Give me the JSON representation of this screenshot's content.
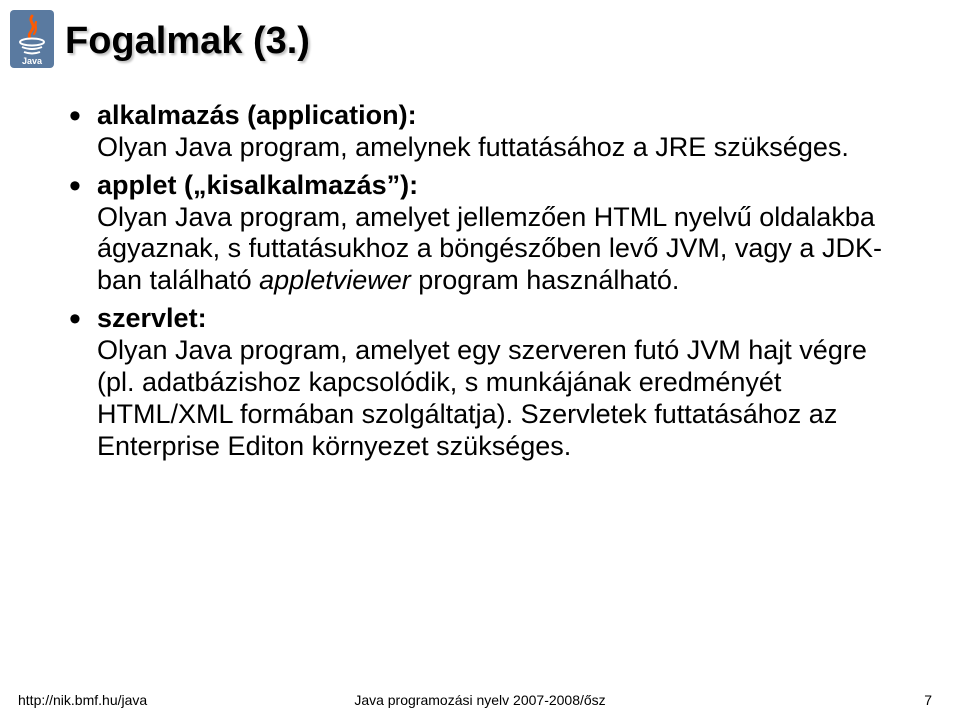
{
  "title": "Fogalmak (3.)",
  "bullets": [
    {
      "term": "alkalmazás (application):",
      "def_parts": [
        {
          "text": "Olyan Java program, amelynek futtatásához a JRE szükséges.",
          "italic": false
        }
      ]
    },
    {
      "term": "applet („kisalkalmazás”):",
      "def_parts": [
        {
          "text": "Olyan Java program, amelyet jellemzően HTML nyelvű oldalakba ágyaznak, s futtatásukhoz a böngészőben levő JVM, vagy a JDK-ban található ",
          "italic": false
        },
        {
          "text": "appletviewer",
          "italic": true
        },
        {
          "text": " program használható.",
          "italic": false
        }
      ]
    },
    {
      "term": "szervlet:",
      "def_parts": [
        {
          "text": "Olyan Java program, amelyet egy szerveren futó JVM hajt végre (pl. adatbázishoz kapcsolódik, s munkájának eredményét HTML/XML formában szolgáltatja). Szervletek futtatásához az Enterprise Editon környezet szükséges.",
          "italic": false
        }
      ]
    }
  ],
  "footer": {
    "left": "http://nik.bmf.hu/java",
    "center": "Java programozási nyelv 2007-2008/ősz",
    "right": "7"
  }
}
